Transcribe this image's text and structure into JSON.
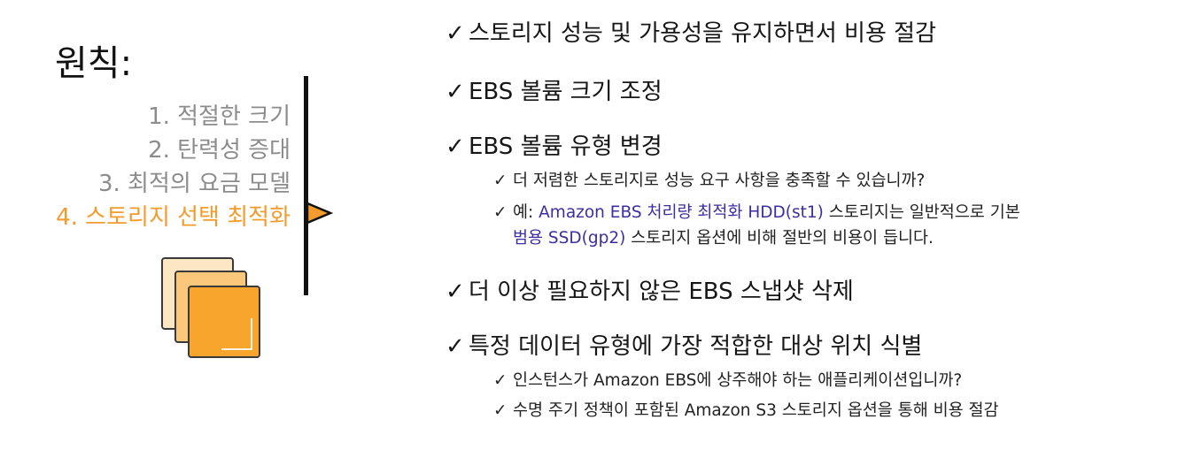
{
  "sidebar": {
    "title": "원칙:",
    "principles": [
      {
        "label": "1. 적절한 크기",
        "active": false
      },
      {
        "label": "2. 탄력성 증대",
        "active": false
      },
      {
        "label": "3. 최적의 요금 모델",
        "active": false
      },
      {
        "label": "4. 스토리지 선택 최적화",
        "active": true
      }
    ],
    "icon": "storage-stack-icon"
  },
  "colors": {
    "active": "#f39b2c",
    "inactive": "#8c8c8c",
    "highlight": "#3b2fa0",
    "storage_orange": "#f7a52c"
  },
  "checkmark": "✓",
  "bullets": {
    "b1": "스토리지 성능 및 가용성을 유지하면서 비용 절감",
    "b2": "EBS 볼륨 크기 조정",
    "b3": "EBS 볼륨 유형 변경",
    "b3_sub1": "더 저렴한 스토리지로 성능 요구 사항을 충족할 수 있습니까?",
    "b3_sub2_prefix": "예: ",
    "b3_sub2_hl1": "Amazon EBS 처리량 최적화 HDD(st1)",
    "b3_sub2_mid": " 스토리지는 일반적으로 기본",
    "b3_sub2_hl2": "범용 SSD(gp2)",
    "b3_sub2_suffix": " 스토리지 옵션에 비해 절반의 비용이 듭니다.",
    "b4": "더 이상 필요하지 않은 EBS 스냅샷 삭제",
    "b5": "특정 데이터 유형에 가장 적합한 대상 위치 식별",
    "b5_sub1": "인스턴스가 Amazon EBS에 상주해야 하는 애플리케이션입니까?",
    "b5_sub2": "수명 주기 정책이 포함된 Amazon S3 스토리지 옵션을 통해 비용 절감"
  }
}
